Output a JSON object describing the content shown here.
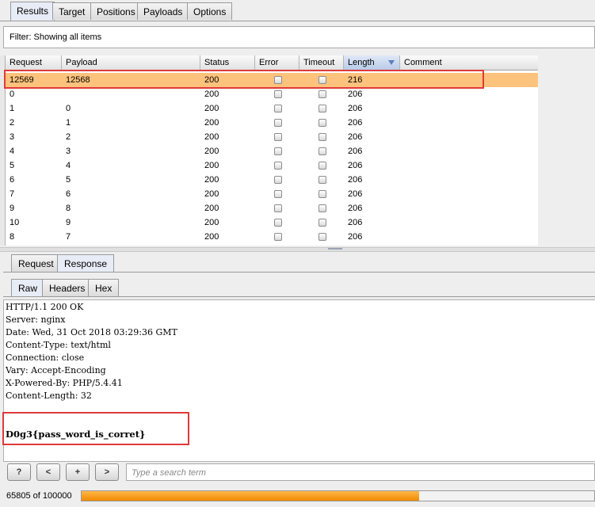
{
  "tabs": [
    "Results",
    "Target",
    "Positions",
    "Payloads",
    "Options"
  ],
  "active_tab": "Results",
  "filter": {
    "text": "Filter: Showing all items"
  },
  "table": {
    "columns": [
      "Request",
      "Payload",
      "Status",
      "Error",
      "Timeout",
      "Length",
      "Comment"
    ],
    "sorted_column": "Length",
    "rows": [
      {
        "request": "12569",
        "payload": "12568",
        "status": "200",
        "error": false,
        "timeout": false,
        "length": "216",
        "comment": "",
        "selected": true
      },
      {
        "request": "0",
        "payload": "",
        "status": "200",
        "error": false,
        "timeout": false,
        "length": "206",
        "comment": ""
      },
      {
        "request": "1",
        "payload": "0",
        "status": "200",
        "error": false,
        "timeout": false,
        "length": "206",
        "comment": ""
      },
      {
        "request": "2",
        "payload": "1",
        "status": "200",
        "error": false,
        "timeout": false,
        "length": "206",
        "comment": ""
      },
      {
        "request": "3",
        "payload": "2",
        "status": "200",
        "error": false,
        "timeout": false,
        "length": "206",
        "comment": ""
      },
      {
        "request": "4",
        "payload": "3",
        "status": "200",
        "error": false,
        "timeout": false,
        "length": "206",
        "comment": ""
      },
      {
        "request": "5",
        "payload": "4",
        "status": "200",
        "error": false,
        "timeout": false,
        "length": "206",
        "comment": ""
      },
      {
        "request": "6",
        "payload": "5",
        "status": "200",
        "error": false,
        "timeout": false,
        "length": "206",
        "comment": ""
      },
      {
        "request": "7",
        "payload": "6",
        "status": "200",
        "error": false,
        "timeout": false,
        "length": "206",
        "comment": ""
      },
      {
        "request": "9",
        "payload": "8",
        "status": "200",
        "error": false,
        "timeout": false,
        "length": "206",
        "comment": ""
      },
      {
        "request": "10",
        "payload": "9",
        "status": "200",
        "error": false,
        "timeout": false,
        "length": "206",
        "comment": ""
      },
      {
        "request": "8",
        "payload": "7",
        "status": "200",
        "error": false,
        "timeout": false,
        "length": "206",
        "comment": ""
      }
    ]
  },
  "message_tabs": {
    "request": "Request",
    "response": "Response",
    "active": "Response"
  },
  "view_tabs": {
    "raw": "Raw",
    "headers": "Headers",
    "hex": "Hex",
    "active": "Raw"
  },
  "response_lines": [
    "HTTP/1.1 200 OK",
    "Server: nginx",
    "Date: Wed, 31 Oct 2018 03:29:36 GMT",
    "Content-Type: text/html",
    "Connection: close",
    "Vary: Accept-Encoding",
    "X-Powered-By: PHP/5.4.41",
    "Content-Length: 32"
  ],
  "response_body": "D0g3{pass_word_is_corret}",
  "bottom": {
    "help_label": "?",
    "prev_label": "<",
    "next_label": "+",
    "last_label": ">",
    "search_placeholder": "Type a search term",
    "progress_text": "65805 of 100000",
    "progress_fraction": 0.658
  },
  "colors": {
    "selected_row": "#fdc27c",
    "highlight_box": "#e03a3a",
    "progress": "#f39a1a"
  }
}
